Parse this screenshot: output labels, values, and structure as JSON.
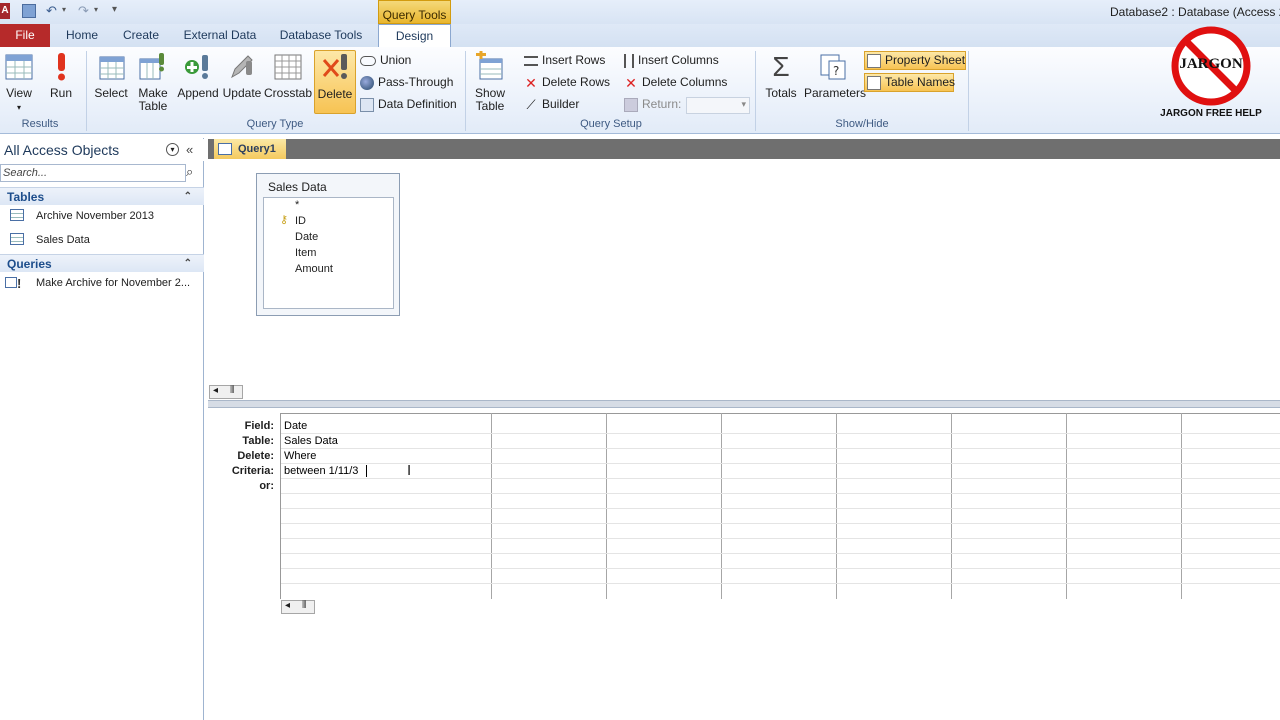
{
  "window": {
    "title": "Database2 : Database (Access 20",
    "app_letter": "A"
  },
  "context_tab": "Query Tools",
  "tabs": [
    "File",
    "Home",
    "Create",
    "External Data",
    "Database Tools",
    "Design"
  ],
  "ribbon": {
    "results": {
      "label": "Results",
      "view": "View",
      "run": "Run"
    },
    "query_type": {
      "label": "Query Type",
      "select": "Select",
      "make_table_1": "Make",
      "make_table_2": "Table",
      "append": "Append",
      "update": "Update",
      "crosstab": "Crosstab",
      "delete": "Delete",
      "union": "Union",
      "pass_through": "Pass-Through",
      "data_definition": "Data Definition"
    },
    "query_setup": {
      "label": "Query Setup",
      "show_table_1": "Show",
      "show_table_2": "Table",
      "insert_rows": "Insert Rows",
      "delete_rows": "Delete Rows",
      "builder": "Builder",
      "insert_columns": "Insert Columns",
      "delete_columns": "Delete Columns",
      "return": "Return:"
    },
    "show_hide": {
      "label": "Show/Hide",
      "totals": "Totals",
      "parameters": "Parameters",
      "property_sheet": "Property Sheet",
      "table_names": "Table Names"
    }
  },
  "logo": {
    "text": "JARGON",
    "caption": "JARGON FREE HELP"
  },
  "nav": {
    "header": "All Access Objects",
    "search_placeholder": "Search...",
    "tables_label": "Tables",
    "tables": [
      "Archive November 2013",
      "Sales Data"
    ],
    "queries_label": "Queries",
    "queries": [
      "Make Archive for November 2..."
    ]
  },
  "doc_tab": "Query1",
  "field_list": {
    "title": "Sales Data",
    "fields": [
      "*",
      "ID",
      "Date",
      "Item",
      "Amount"
    ]
  },
  "design_grid": {
    "row_labels": [
      "Field:",
      "Table:",
      "Delete:",
      "Criteria:",
      "or:"
    ],
    "col1": {
      "field": "Date",
      "table": "Sales Data",
      "delete": "Where",
      "criteria": "between 1/11/3"
    }
  },
  "colors": {
    "file_tab": "#b62a2a",
    "context_tab": "#e9b62e",
    "ribbon_bg": "#e2ebf8",
    "nav_category": "#1e4e8c"
  }
}
